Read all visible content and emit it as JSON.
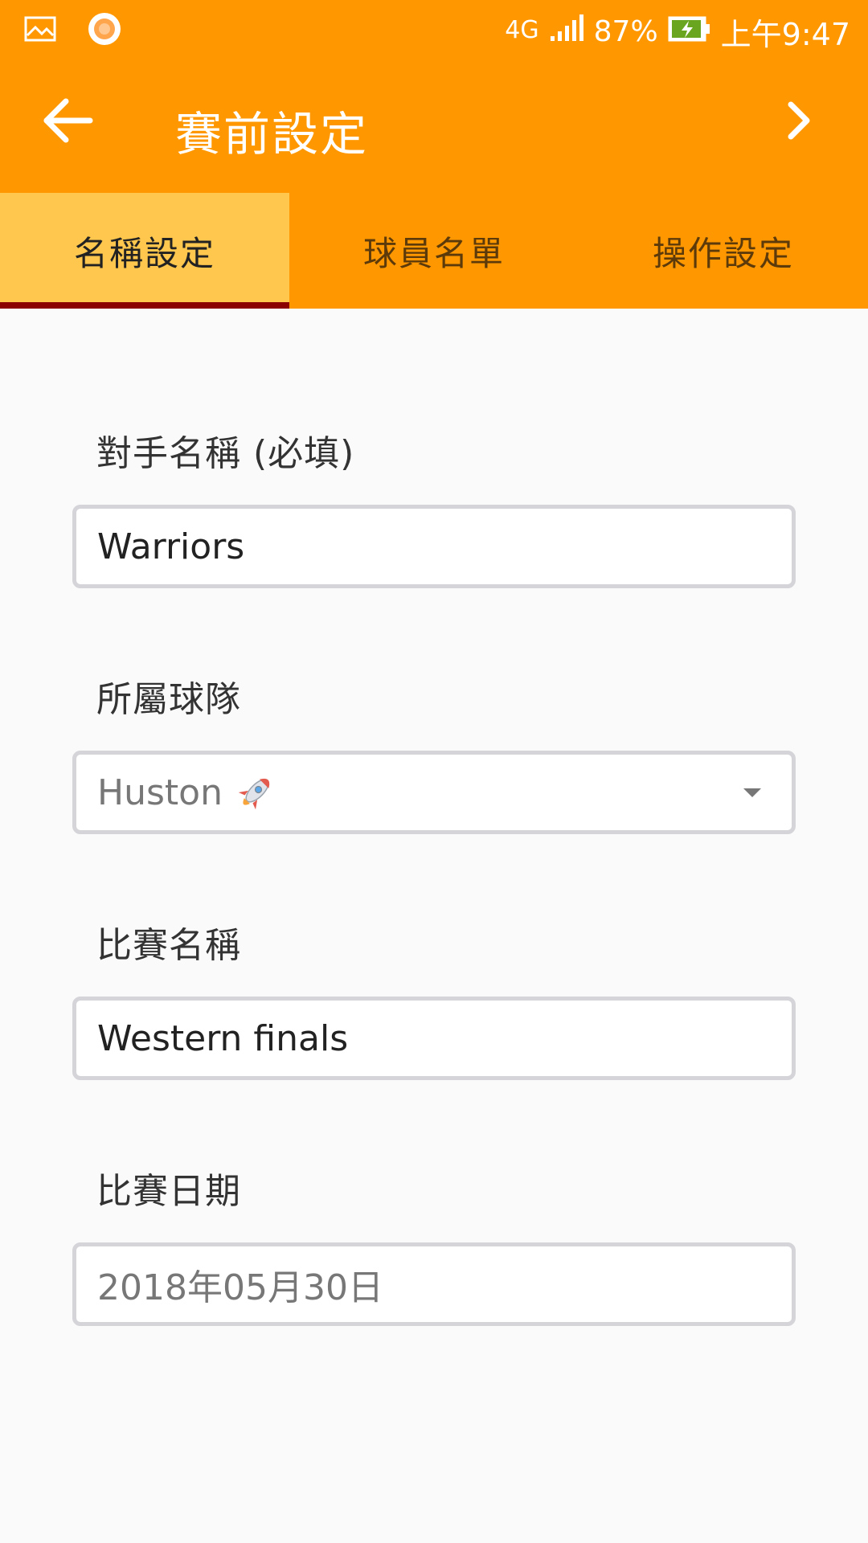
{
  "status_bar": {
    "network": "4G",
    "battery_percent": "87%",
    "time": "上午9:47",
    "icons": [
      "gallery-icon",
      "record-icon",
      "signal-icon",
      "battery-charging-icon"
    ]
  },
  "app_bar": {
    "title": "賽前設定",
    "back_icon": "arrow-left-icon",
    "next_icon": "chevron-right-icon"
  },
  "tabs": [
    {
      "label": "名稱設定",
      "active": true
    },
    {
      "label": "球員名單",
      "active": false
    },
    {
      "label": "操作設定",
      "active": false
    }
  ],
  "form": {
    "opponent": {
      "label": "對手名稱 (必填)",
      "value": "Warriors"
    },
    "team": {
      "label": "所屬球隊",
      "value": "Huston",
      "icon": "rocket-icon"
    },
    "match_name": {
      "label": "比賽名稱",
      "value": "Western finals"
    },
    "match_date": {
      "label": "比賽日期",
      "value": "2018年05月30日"
    }
  },
  "colors": {
    "primary": "#ff9800",
    "active_tab": "#ffc74d",
    "tab_indicator": "#8b0000",
    "background": "#fafafa"
  }
}
